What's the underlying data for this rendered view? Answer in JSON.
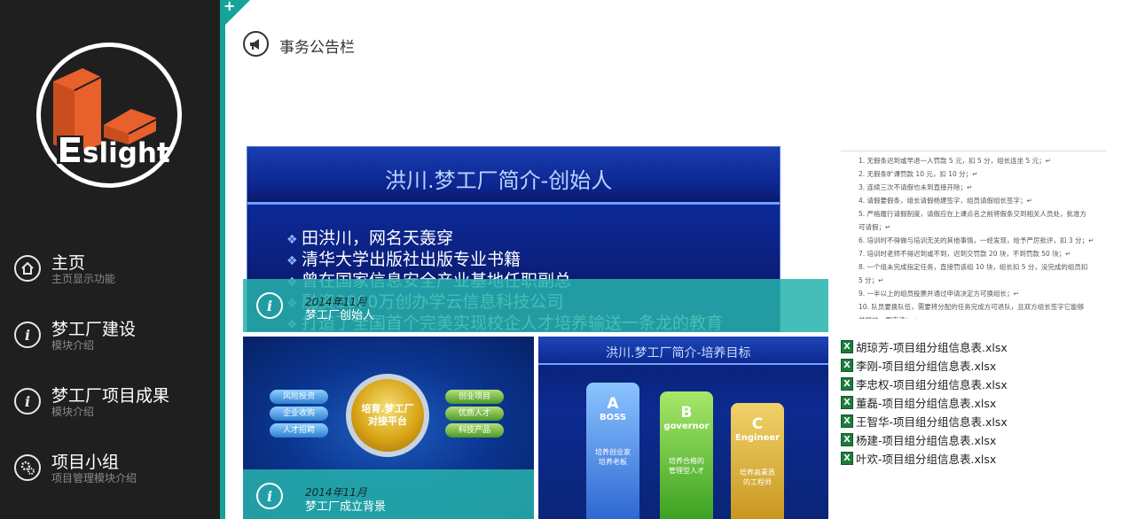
{
  "logo": {
    "text": "Eslight",
    "colors": {
      "orange": "#e8602b",
      "ring": "#ffffff"
    }
  },
  "nav": [
    {
      "icon": "home-icon",
      "title": "主页",
      "sub": "主页显示功能"
    },
    {
      "icon": "info-icon",
      "title": "梦工厂建设",
      "sub": "模块介绍"
    },
    {
      "icon": "info-icon",
      "title": "梦工厂项目成果",
      "sub": "模块介绍"
    },
    {
      "icon": "gears-icon",
      "title": "项目小组",
      "sub": "项目管理模块介绍"
    }
  ],
  "notice": {
    "title": "事务公告栏",
    "icon": "megaphone-icon"
  },
  "corner_plus": "+",
  "tiles": {
    "founder": {
      "slide_title": "洪川.梦工厂简介-创始人",
      "bullets": [
        "田洪川，网名天轰穿",
        "清华大学出版社出版专业书籍",
        "曾在国家信息安全产业基地任职副总",
        "融资2000万创办学云信息科技公司",
        "打造了全国首个完美实现校企人才培养输送一条龙的教育"
      ],
      "date": "2014年11月",
      "caption": "梦工厂创始人"
    },
    "background": {
      "left_items": [
        "风险投资",
        "企业收购",
        "人才招聘"
      ],
      "center": "培育.梦工厂 对接平台",
      "right_items": [
        "创业项目",
        "优质人才",
        "科技产品"
      ],
      "date": "2014年11月",
      "caption": "梦工厂成立背景"
    },
    "goals": {
      "slide_title": "洪川.梦工厂简介-培养目标",
      "boxes": [
        {
          "letter": "A",
          "name": "BOSS",
          "desc": "培养创业家 培养老板"
        },
        {
          "letter": "B",
          "name": "governor",
          "desc": "培养合格的 管理型人才"
        },
        {
          "letter": "C",
          "name": "Engineer",
          "desc": "培养高素质 的工程师"
        }
      ]
    }
  },
  "doc_lines": [
    "1.  无假条迟到或早退一人罚款 5 元，扣 5 分，组长连坐 5 元；↵",
    "2.  无假条旷课罚款 10 元，扣 10 分；↵",
    "3.  连续三次不请假也未到直接开除；↵",
    "4.  请假要假条，组长请假杨建签字，组员请假组长签字；↵",
    "5.  严格履行请假制度，请假应在上课点名之前将假条交到相关人员处，批准方",
    "     可请假；↵",
    "6.  培训时不得做与培训无关的其他事情，一经发现，给予严厉批评，扣 3 分；↵",
    "7.  培训时老师不得迟到或不到，迟到交罚款 20 块，不到罚款 50 块；↵",
    "8.  一个组未完成指定任务，直接罚该组 10 块，组长扣 5 分，没完成的组员扣",
    "     5 分；↵",
    "9.  一半以上的组员投票并通过申请决定方可换组长；↵",
    "10. 队员要换队伍，需要将分配的任务完成方可退队，且双方组长签字它能够",
    "     并提前一周申请；↵"
  ],
  "files": [
    "胡琼芳-项目组分组信息表.xlsx",
    "李刚-项目组分组信息表.xlsx",
    "李忠权-项目组分组信息表.xlsx",
    "董磊-项目组分组信息表.xlsx",
    "王智华-项目组分组信息表.xlsx",
    "杨建-项目组分组信息表.xlsx",
    "叶欢-项目组分组信息表.xlsx"
  ],
  "file_icon_letter": "X"
}
